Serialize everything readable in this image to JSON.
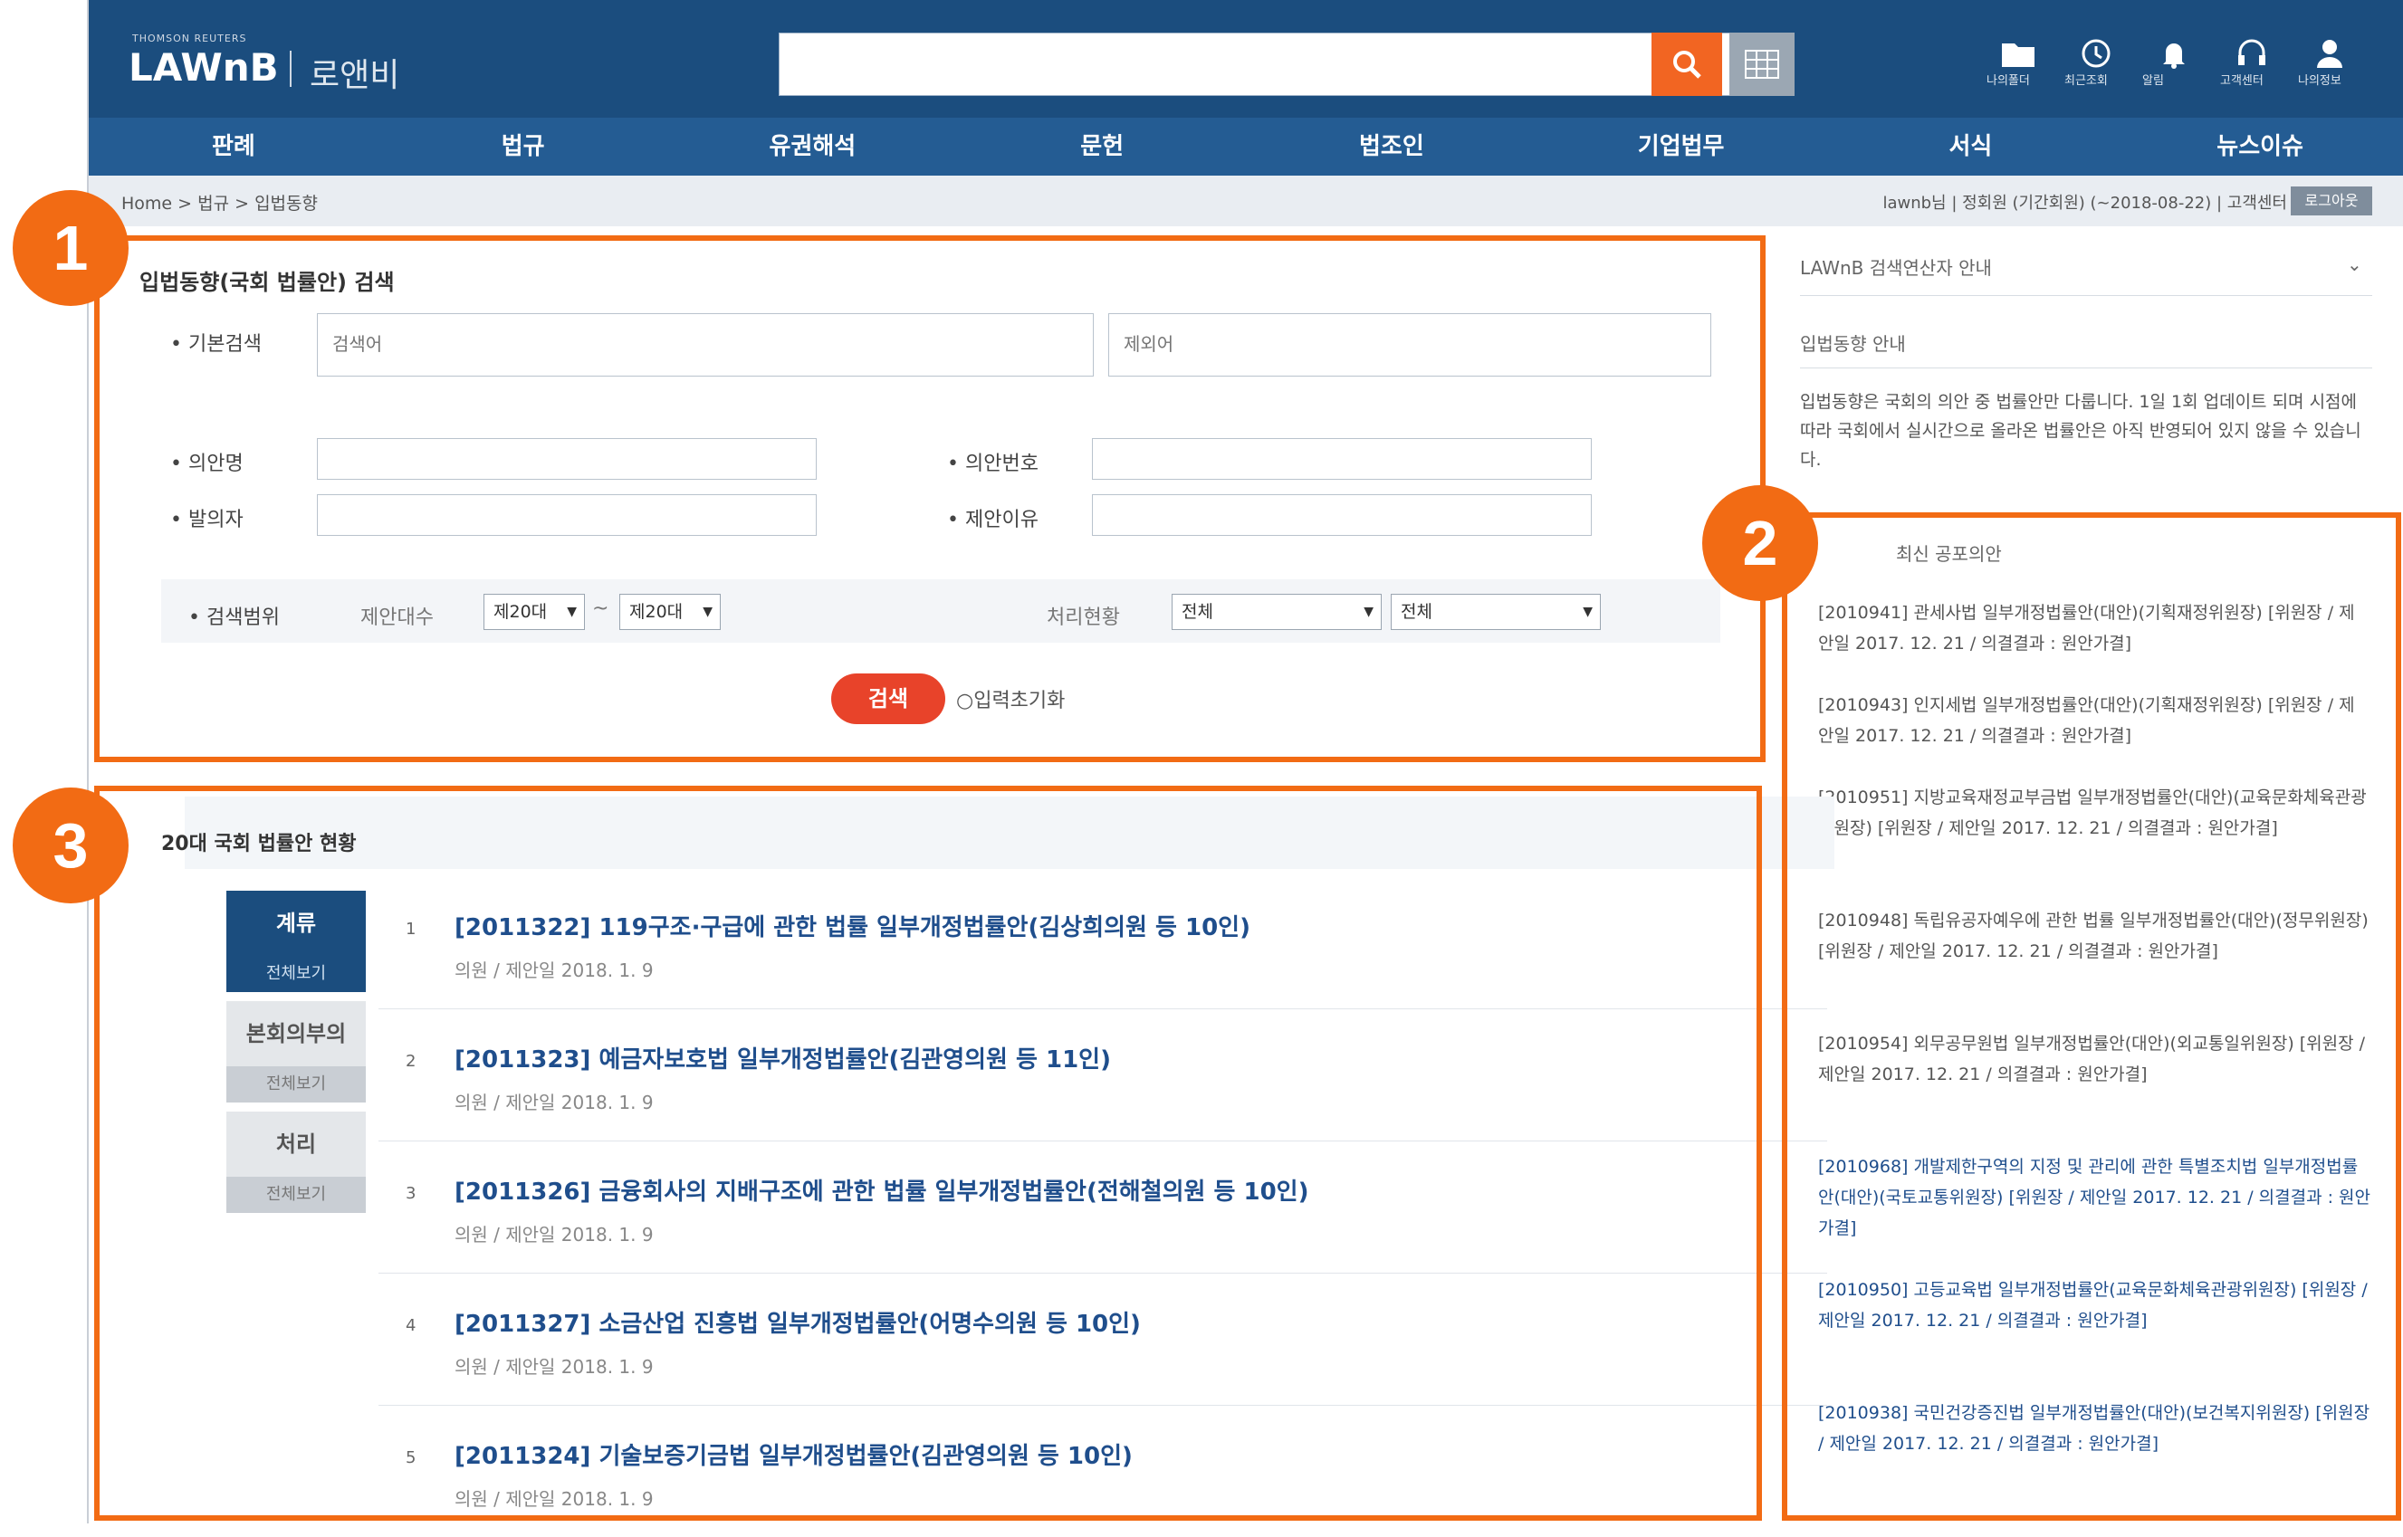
{
  "header": {
    "brand_sub": "THOMSON REUTERS",
    "brand": "LAWnB",
    "brand_kr": "로앤비",
    "search_placeholder": "",
    "icons": [
      {
        "name": "folder-icon",
        "label": "나의폴더"
      },
      {
        "name": "history-icon",
        "label": "최근조회"
      },
      {
        "name": "bell-icon",
        "label": "알림"
      },
      {
        "name": "headset-icon",
        "label": "고객센터"
      },
      {
        "name": "user-icon",
        "label": "나의정보"
      }
    ]
  },
  "nav": [
    "판례",
    "법규",
    "유권해석",
    "문헌",
    "법조인",
    "기업법무",
    "서식",
    "뉴스이슈"
  ],
  "breadcrumb": {
    "path": "Home > 법규 > 입법동향",
    "right": "lawnb님 | 정회원 (기간회원) (~2018-08-22) | 고객센터",
    "button": "로그아웃"
  },
  "annotations": {
    "one": "1",
    "two": "2",
    "three": "3"
  },
  "search_section": {
    "title": "입법동향(국회 법률안) 검색",
    "basic_label": "• 기본검색",
    "basic_placeholder_1": "검색어",
    "basic_placeholder_2": "제외어",
    "bill_name_label": "• 의안명",
    "bill_no_label": "• 의안번호",
    "proposer_label": "• 발의자",
    "reason_label": "• 제안이유",
    "range_label": "• 검색범위",
    "session_label": "제안대수",
    "session_from": "제20대",
    "tilde": "~",
    "session_to": "제20대",
    "status_label": "처리현황",
    "status_1": "전체",
    "status_2": "전체",
    "search_button": "검색",
    "reset_label": "입력초기화"
  },
  "side": {
    "guide_title": "LAWnB 검색연산자 안내",
    "trend_title": "입법동향 안내",
    "trend_text": "입법동향은 국회의 의안 중 법률안만 다룹니다. 1일 1회 업데이트 되며 시점에 따라 국회에서 실시간으로 올라온 법률안은 아직 반영되어 있지 않을 수 있습니다.",
    "latest_title": "최신 공포의안",
    "items": [
      {
        "text": "[2010941] 관세사법 일부개정법률안(대안)(기획재정위원장) [위원장 / 제안일 2017. 12. 21 / 의결결과 : 원안가결]",
        "style": "gray"
      },
      {
        "text": "[2010943] 인지세법 일부개정법률안(대안)(기획재정위원장) [위원장 / 제안일 2017. 12. 21 / 의결결과 : 원안가결]",
        "style": "gray"
      },
      {
        "text": "[2010951] 지방교육재정교부금법 일부개정법률안(대안)(교육문화체육관광위원장) [위원장 / 제안일 2017. 12. 21 / 의결결과 : 원안가결]",
        "style": "gray"
      },
      {
        "text": "[2010948] 독립유공자예우에 관한 법률 일부개정법률안(대안)(정무위원장) [위원장 / 제안일 2017. 12. 21 / 의결결과 : 원안가결]",
        "style": "gray"
      },
      {
        "text": "[2010954] 외무공무원법 일부개정법률안(대안)(외교통일위원장) [위원장 / 제안일 2017. 12. 21 / 의결결과 : 원안가결]",
        "style": "gray"
      },
      {
        "text": "[2010968] 개발제한구역의 지정 및 관리에 관한 특별조치법 일부개정법률안(대안)(국토교통위원장) [위원장 / 제안일 2017. 12. 21 / 의결결과 : 원안가결]",
        "style": "blue"
      },
      {
        "text": "[2010950] 고등교육법 일부개정법률안(교육문화체육관광위원장) [위원장 / 제안일 2017. 12. 21 / 의결결과 : 원안가결]",
        "style": "blue"
      },
      {
        "text": "[2010938] 국민건강증진법 일부개정법률안(대안)(보건복지위원장) [위원장 / 제안일 2017. 12. 21 / 의결결과 : 원안가결]",
        "style": "blue"
      }
    ]
  },
  "list_section": {
    "title": "20대 국회 법률안 현황",
    "tabs": [
      {
        "label": "계류",
        "more": "전체보기"
      },
      {
        "label": "본회의부의",
        "more": "전체보기"
      },
      {
        "label": "처리",
        "more": "전체보기"
      }
    ],
    "rows": [
      {
        "num": "1",
        "title": "[2011322] 119구조·구급에 관한 법률 일부개정법률안(김상희의원 등 10인)",
        "meta": "의원 / 제안일 2018. 1. 9"
      },
      {
        "num": "2",
        "title": "[2011323] 예금자보호법 일부개정법률안(김관영의원 등 11인)",
        "meta": "의원 / 제안일 2018. 1. 9"
      },
      {
        "num": "3",
        "title": "[2011326] 금융회사의 지배구조에 관한 법률 일부개정법률안(전해철의원 등 10인)",
        "meta": "의원 / 제안일 2018. 1. 9"
      },
      {
        "num": "4",
        "title": "[2011327] 소금산업 진흥법 일부개정법률안(어명수의원 등 10인)",
        "meta": "의원 / 제안일 2018. 1. 9"
      },
      {
        "num": "5",
        "title": "[2011324] 기술보증기금법 일부개정법률안(김관영의원 등 10인)",
        "meta": "의원 / 제안일 2018. 1. 9"
      }
    ]
  },
  "colors": {
    "header": "#1b4d7e",
    "nav": "#245c93",
    "accent": "#f26b14",
    "link": "#1f4e8c"
  }
}
